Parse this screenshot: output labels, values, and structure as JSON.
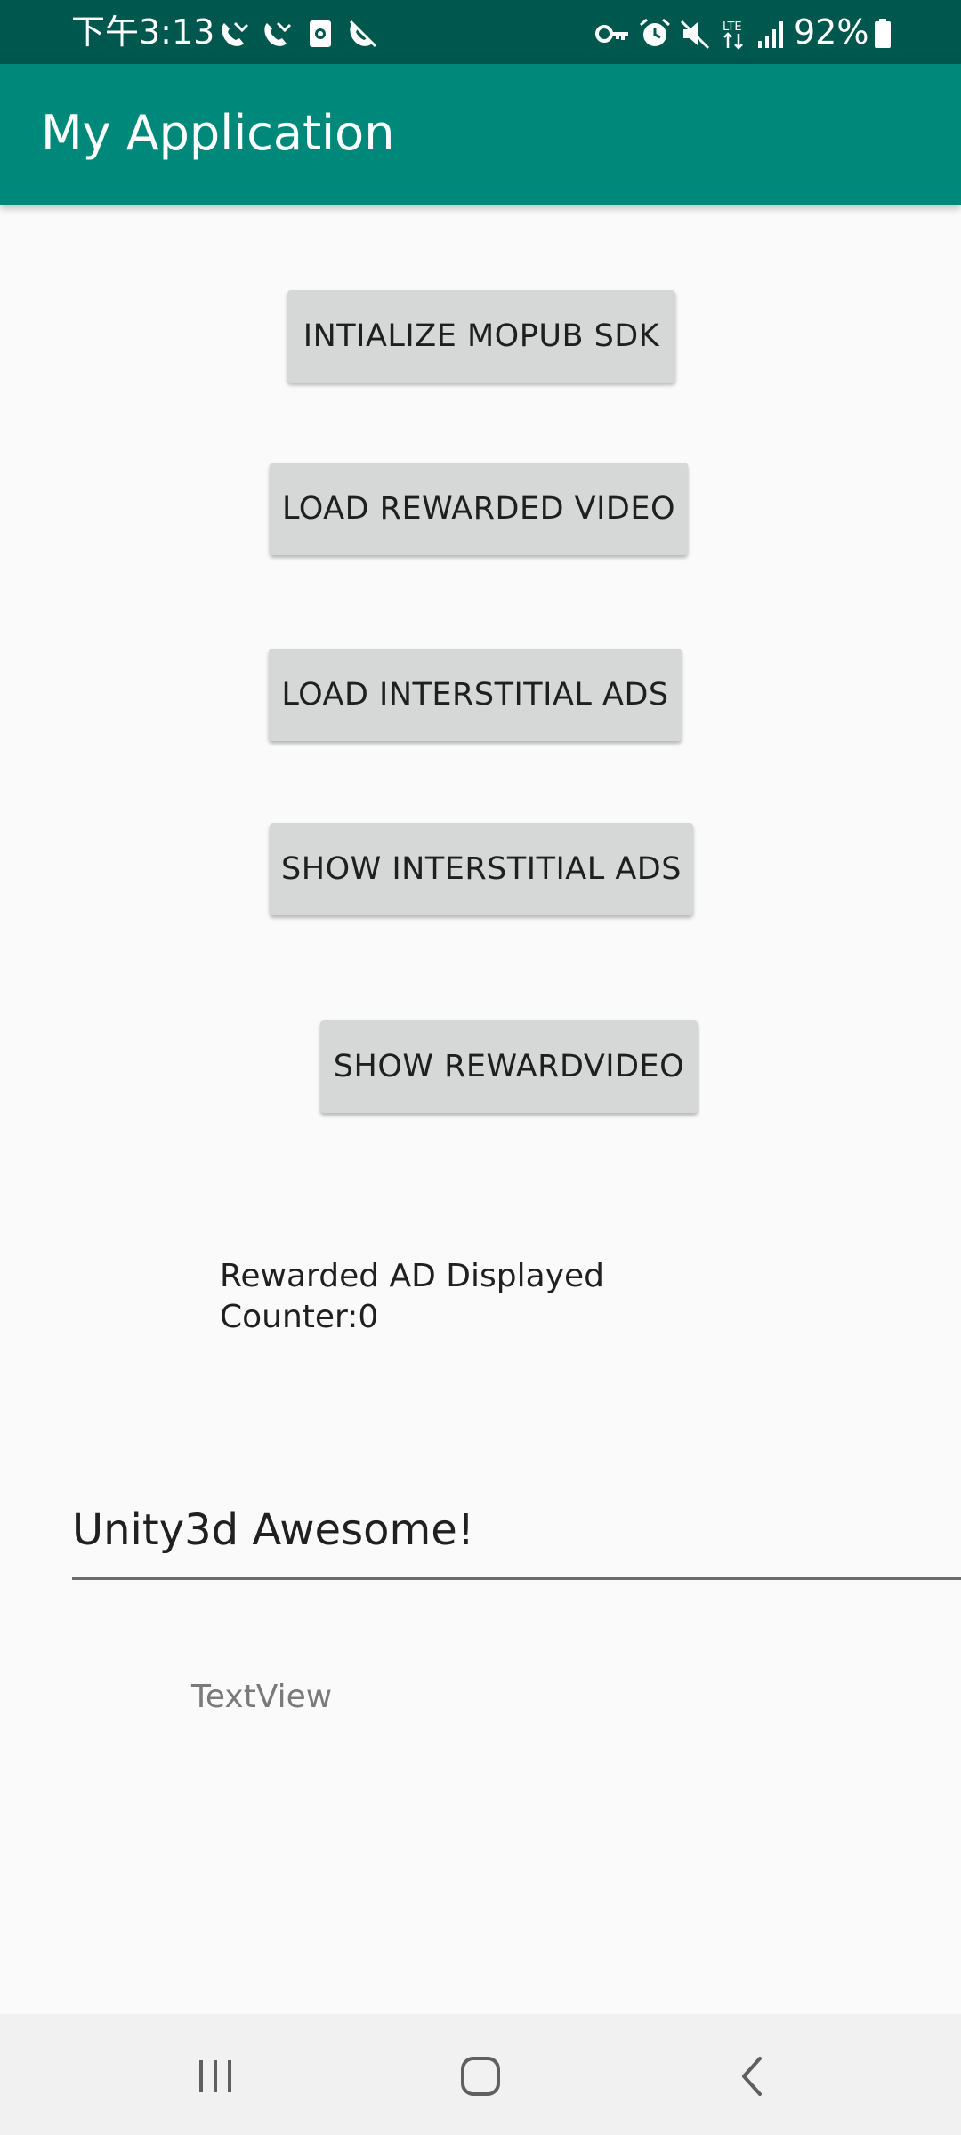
{
  "status_bar": {
    "time": "下午3:13",
    "battery": "92%",
    "left_icons": [
      "missed-call-icon",
      "missed-call-icon",
      "screen-record-icon",
      "call-muted-icon"
    ],
    "right_icons": [
      "key-icon",
      "alarm-icon",
      "mute-icon",
      "lte-icon",
      "signal-icon",
      "battery-icon"
    ]
  },
  "app_bar": {
    "title": "My Application",
    "color": "#00897b",
    "status_color": "#00574d"
  },
  "buttons": {
    "init_sdk": "INTIALIZE MOPUB SDK",
    "load_rewarded": "LOAD REWARDED VIDEO",
    "load_interstitial": "LOAD INTERSTITIAL ADS",
    "show_interstitial": "SHOW INTERSTITIAL ADS",
    "show_rewarded": "SHOW REWARDVIDEO"
  },
  "counter": {
    "line1": "Rewarded AD Displayed",
    "line2": "Counter:0"
  },
  "input": {
    "value": "Unity3d Awesome!"
  },
  "text_view": {
    "text": "TextView"
  },
  "nav_bar": {
    "icons": [
      "recents-icon",
      "home-icon",
      "back-icon"
    ]
  }
}
